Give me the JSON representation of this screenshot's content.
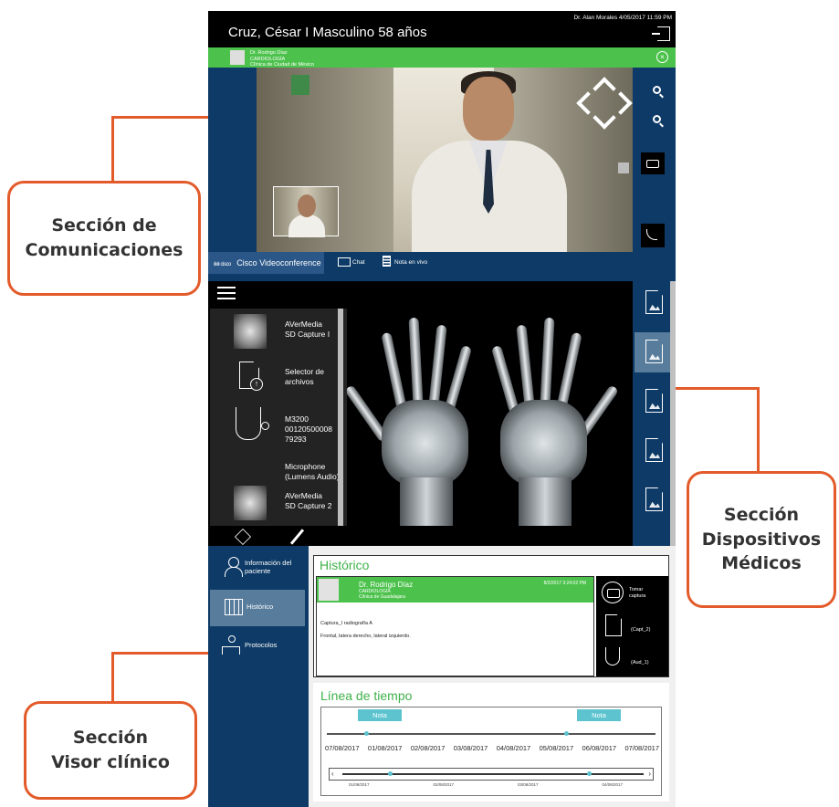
{
  "header": {
    "patient_title": "Cruz, César I Masculino 58 años",
    "doctor_stamp": "Dr. Alan Morales 4/05/2017 11:59 PM"
  },
  "call": {
    "remote_name": "Dr. Rodrigo Díaz",
    "remote_sub1": "CARDIOLOGÍA",
    "remote_sub2": "Clínica de Ciudad de México",
    "close_glyph": "×"
  },
  "comm_tabs": {
    "cisco_logo": "ılıılı cisco",
    "cisco_label": "Cisco Videoconference",
    "chat_label": "Chat",
    "note_label": "Nota en vivo"
  },
  "devices": [
    {
      "label": "AVerMedia\nSD Capture I",
      "kind": "xray"
    },
    {
      "label": "Selector de\narchivos",
      "kind": "file"
    },
    {
      "label": "M3200\n00120500008\n79293",
      "kind": "stethoscope"
    },
    {
      "label": "Microphone\n(Lumens Audio)",
      "kind": "mic"
    },
    {
      "label": "AVerMedia\nSD Capture 2",
      "kind": "xray"
    }
  ],
  "viewer_nav": {
    "patient_info": "Información del paciente",
    "history": "Histórico",
    "protocols": "Protocolos"
  },
  "history": {
    "title": "Histórico",
    "doctor": "Dr. Rodrigo Díaz",
    "specialty": "CARDIOLOGÍA",
    "clinic": "Clínica de Guadalajara",
    "date": "8/2/2017 3:24:02 PM",
    "line1": "Captura_I radiografía A",
    "line2": "Frontal, latera derecho, lateral izquierdo.",
    "capture_label": "Tomar captura",
    "capt2_label": "(Capt_2)",
    "aud1_label": "(Aud_1)"
  },
  "timeline": {
    "title": "Línea de tiempo",
    "note_label": "Nota",
    "dates": [
      "07/08/2017",
      "01/08/2017",
      "02/08/2017",
      "03/08/2017",
      "04/08/2017",
      "05/08/2017",
      "06/08/2017",
      "07/08/2017"
    ],
    "mini_dates": [
      "01/08/2017",
      "02/08/2017",
      "03/08/2017",
      "04/08/2017"
    ]
  },
  "callouts": {
    "comunicaciones": "Sección de\nComunicaciones",
    "dispositivos": "Sección\nDispositivos\nMédicos",
    "visor": "Sección\nVisor clínico"
  },
  "colors": {
    "navy": "#0d3a66",
    "green": "#4cc24c",
    "accent_orange": "#e35b2a",
    "timeline_note": "#5cc3cf"
  }
}
